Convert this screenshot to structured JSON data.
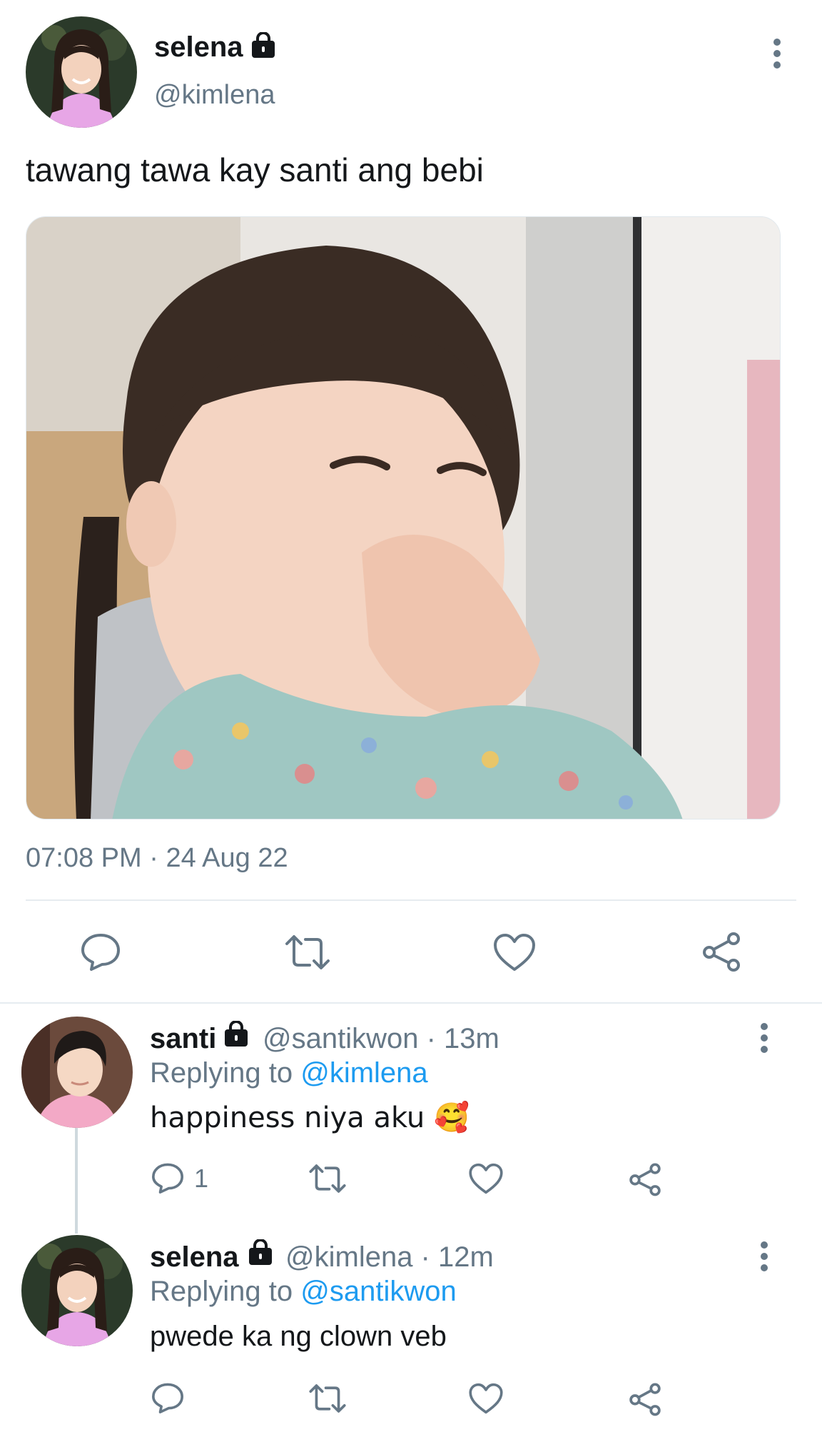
{
  "tweet": {
    "display_name": "selena",
    "handle": "@kimlena",
    "text": "tawang tawa kay santi ang bebi",
    "time": "07:08 PM",
    "date_sep": " · ",
    "date": "24 Aug 22",
    "avatar_icon": "avatar-selena",
    "media_icon": "photo-laughing-toddler",
    "protected_icon": "lock-icon",
    "more_icon": "more-vertical-icon"
  },
  "actions": {
    "reply_icon": "reply-icon",
    "retweet_icon": "retweet-icon",
    "like_icon": "like-icon",
    "share_icon": "share-icon"
  },
  "replies": [
    {
      "display_name": "santi",
      "handle": "@santikwon",
      "meta_sep": " · ",
      "age": "13m",
      "replying_prefix": "Replying to ",
      "replying_to": "@kimlena",
      "text": "happiness niya aku 🥰",
      "reply_count": "1",
      "avatar_icon": "avatar-santi"
    },
    {
      "display_name": "selena",
      "handle": "@kimlena",
      "meta_sep": " · ",
      "age": "12m",
      "replying_prefix": "Replying to ",
      "replying_to": "@santikwon",
      "text": "pwede ka ng clown veb",
      "reply_count": "",
      "avatar_icon": "avatar-selena"
    }
  ],
  "colors": {
    "text": "#14171a",
    "muted": "#657786",
    "link": "#1d9bf0",
    "divider": "#e6ecf0",
    "icon": "#657786"
  }
}
